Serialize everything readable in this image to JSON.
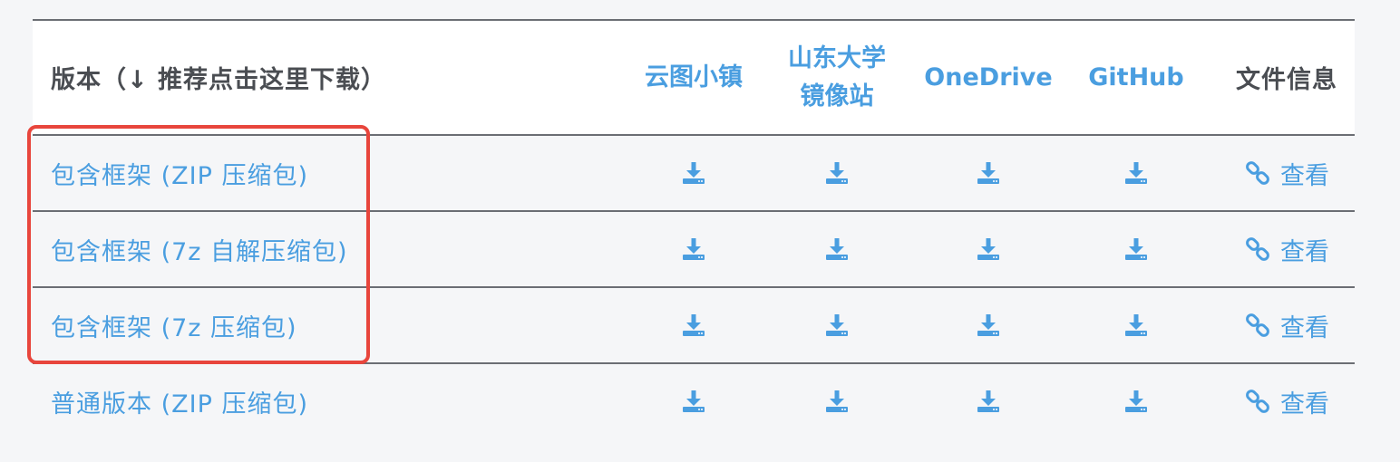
{
  "table": {
    "headers": {
      "version": "版本（↓ 推荐点击这里下载）",
      "mirror1": "云图小镇",
      "mirror2_line1": "山东大学",
      "mirror2_line2": "镜像站",
      "mirror3": "OneDrive",
      "mirror4": "GitHub",
      "info": "文件信息"
    },
    "rows": [
      {
        "label": "包含框架 (ZIP 压缩包)",
        "view": "查看"
      },
      {
        "label": "包含框架 (7z 自解压缩包)",
        "view": "查看"
      },
      {
        "label": "包含框架 (7z 压缩包)",
        "view": "查看"
      },
      {
        "label": "普通版本 (ZIP 压缩包)",
        "view": "查看"
      }
    ]
  },
  "icons": {
    "download": "download-icon",
    "link": "link-icon"
  },
  "colors": {
    "link": "#4a9ee0",
    "header_text": "#4a4d52",
    "highlight": "#e8453c",
    "border": "#6b6e74",
    "background": "#f5f6f8"
  }
}
